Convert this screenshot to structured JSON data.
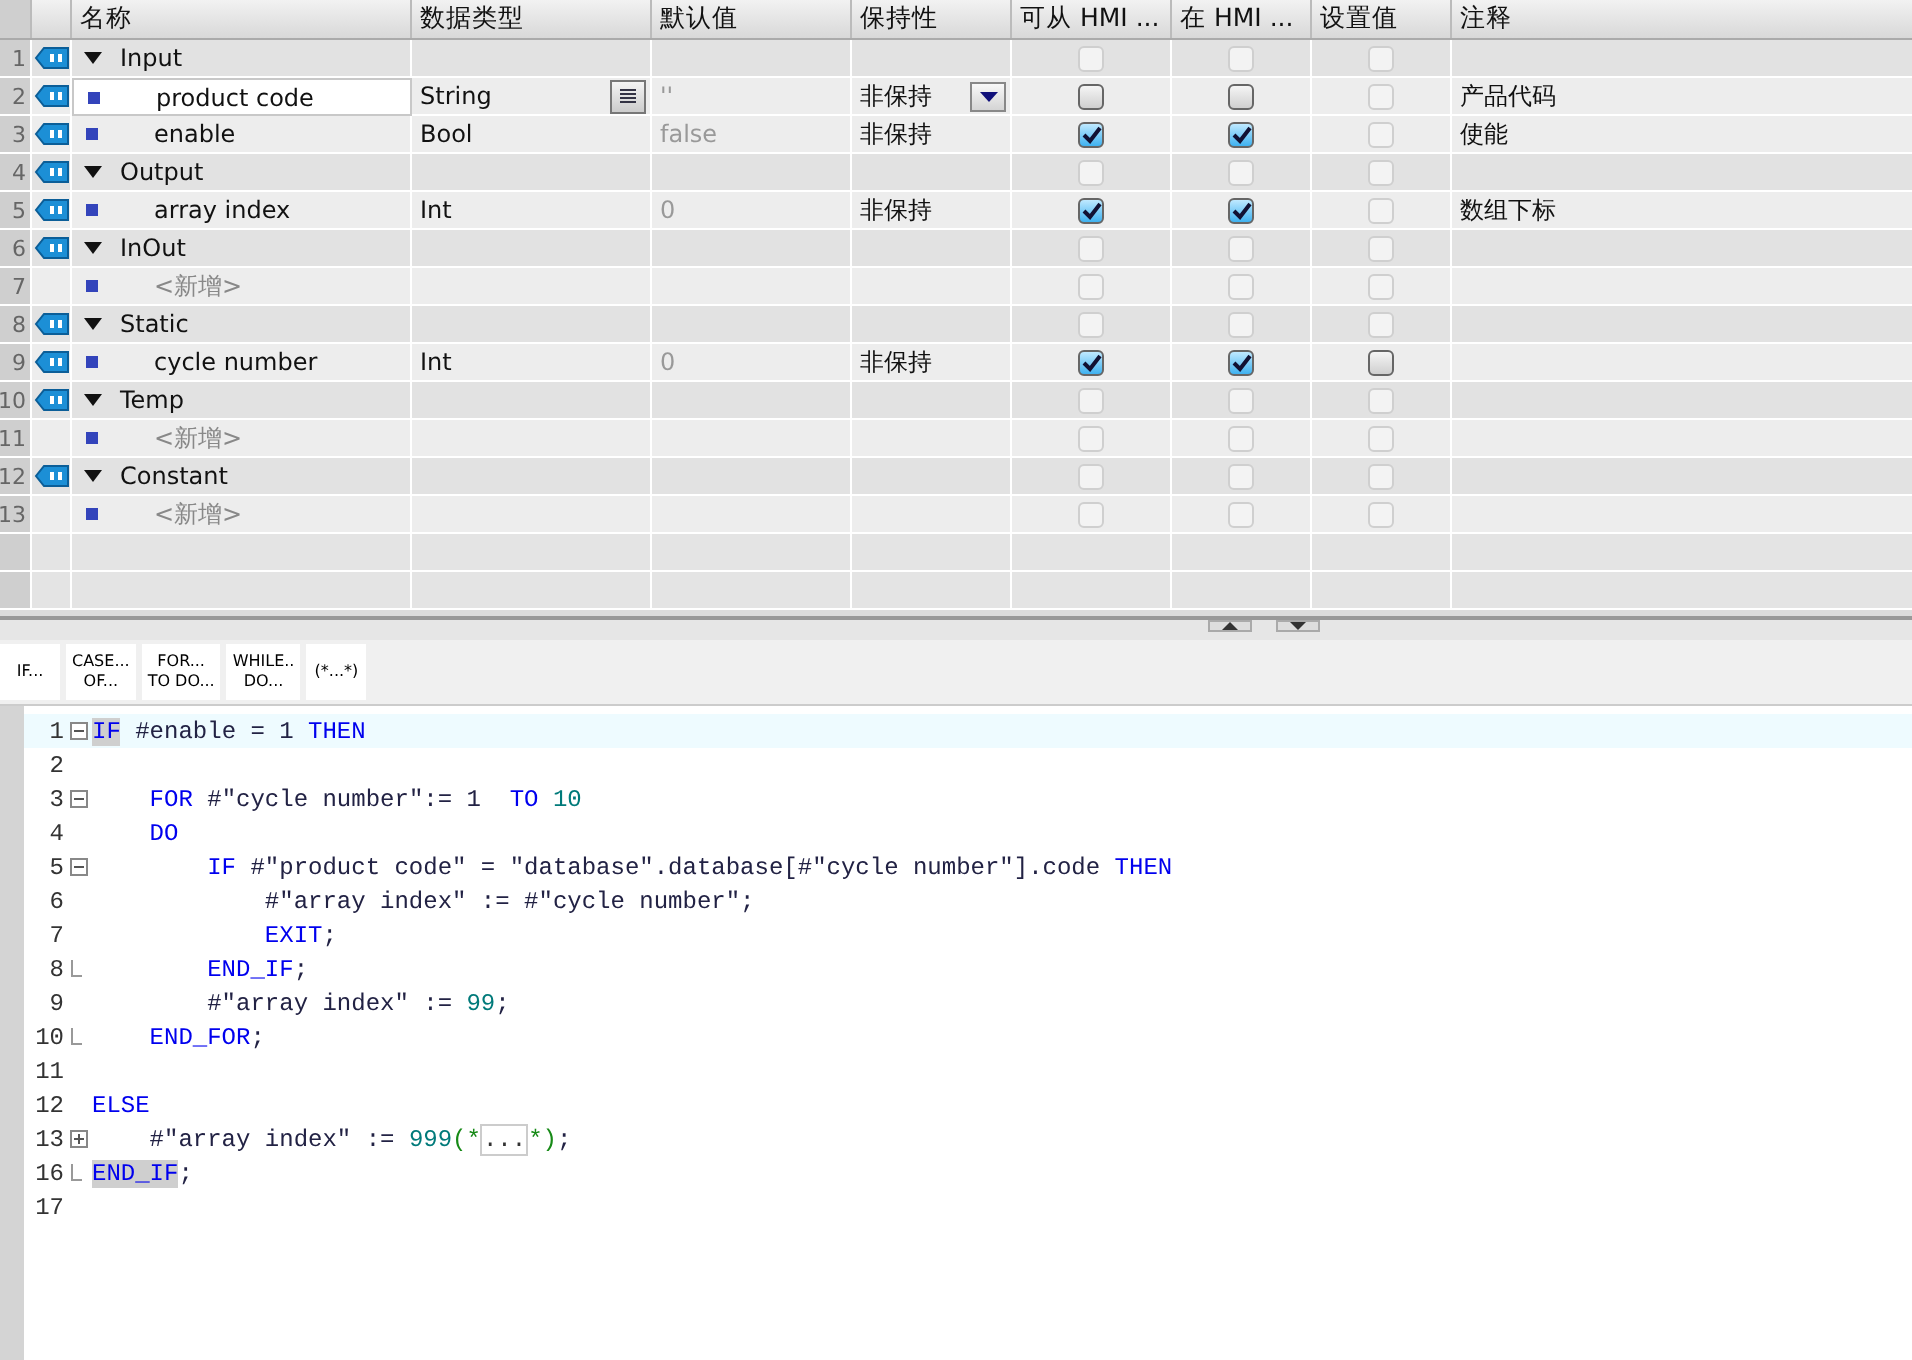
{
  "table": {
    "columns": [
      "名称",
      "数据类型",
      "默认值",
      "保持性",
      "可从 HMI ...",
      "在 HMI ...",
      "设置值",
      "注释"
    ],
    "rows": [
      {
        "number": "1",
        "kind": "section",
        "name": "Input",
        "type": "",
        "default": "",
        "retain": "",
        "comment": "",
        "selected": false,
        "checks": [
          {
            "checked": false,
            "enabled": false
          },
          {
            "checked": false,
            "enabled": false
          },
          {
            "checked": false,
            "enabled": false
          }
        ]
      },
      {
        "number": "2",
        "kind": "variable",
        "name": "product code",
        "type": "String",
        "default": "''",
        "retain": "非保持",
        "comment": "产品代码",
        "selected": true,
        "checks": [
          {
            "checked": false,
            "enabled": true
          },
          {
            "checked": false,
            "enabled": true
          },
          {
            "checked": false,
            "enabled": false
          }
        ]
      },
      {
        "number": "3",
        "kind": "variable",
        "name": "enable",
        "type": "Bool",
        "default": "false",
        "retain": "非保持",
        "comment": "使能",
        "selected": false,
        "checks": [
          {
            "checked": true,
            "enabled": true
          },
          {
            "checked": true,
            "enabled": true
          },
          {
            "checked": false,
            "enabled": false
          }
        ]
      },
      {
        "number": "4",
        "kind": "section",
        "name": "Output",
        "type": "",
        "default": "",
        "retain": "",
        "comment": "",
        "selected": false,
        "checks": [
          {
            "checked": false,
            "enabled": false
          },
          {
            "checked": false,
            "enabled": false
          },
          {
            "checked": false,
            "enabled": false
          }
        ]
      },
      {
        "number": "5",
        "kind": "variable",
        "name": "array index",
        "type": "Int",
        "default": "0",
        "retain": "非保持",
        "comment": "数组下标",
        "selected": false,
        "checks": [
          {
            "checked": true,
            "enabled": true
          },
          {
            "checked": true,
            "enabled": true
          },
          {
            "checked": false,
            "enabled": false
          }
        ]
      },
      {
        "number": "6",
        "kind": "section",
        "name": "InOut",
        "type": "",
        "default": "",
        "retain": "",
        "comment": "",
        "selected": false,
        "checks": [
          {
            "checked": false,
            "enabled": false
          },
          {
            "checked": false,
            "enabled": false
          },
          {
            "checked": false,
            "enabled": false
          }
        ]
      },
      {
        "number": "7",
        "kind": "add",
        "name": "<新增>",
        "type": "",
        "default": "",
        "retain": "",
        "comment": "",
        "selected": false,
        "checks": [
          {
            "checked": false,
            "enabled": false
          },
          {
            "checked": false,
            "enabled": false
          },
          {
            "checked": false,
            "enabled": false
          }
        ]
      },
      {
        "number": "8",
        "kind": "section",
        "name": "Static",
        "type": "",
        "default": "",
        "retain": "",
        "comment": "",
        "selected": false,
        "checks": [
          {
            "checked": false,
            "enabled": false
          },
          {
            "checked": false,
            "enabled": false
          },
          {
            "checked": false,
            "enabled": false
          }
        ]
      },
      {
        "number": "9",
        "kind": "variable",
        "name": "cycle number",
        "type": "Int",
        "default": "0",
        "retain": "非保持",
        "comment": "",
        "selected": false,
        "checks": [
          {
            "checked": true,
            "enabled": true
          },
          {
            "checked": true,
            "enabled": true
          },
          {
            "checked": false,
            "enabled": true
          }
        ]
      },
      {
        "number": "10",
        "kind": "section",
        "name": "Temp",
        "type": "",
        "default": "",
        "retain": "",
        "comment": "",
        "selected": false,
        "checks": [
          {
            "checked": false,
            "enabled": false
          },
          {
            "checked": false,
            "enabled": false
          },
          {
            "checked": false,
            "enabled": false
          }
        ]
      },
      {
        "number": "11",
        "kind": "add",
        "name": "<新增>",
        "type": "",
        "default": "",
        "retain": "",
        "comment": "",
        "selected": false,
        "checks": [
          {
            "checked": false,
            "enabled": false
          },
          {
            "checked": false,
            "enabled": false
          },
          {
            "checked": false,
            "enabled": false
          }
        ]
      },
      {
        "number": "12",
        "kind": "section",
        "name": "Constant",
        "type": "",
        "default": "",
        "retain": "",
        "comment": "",
        "selected": false,
        "checks": [
          {
            "checked": false,
            "enabled": false
          },
          {
            "checked": false,
            "enabled": false
          },
          {
            "checked": false,
            "enabled": false
          }
        ]
      },
      {
        "number": "13",
        "kind": "add",
        "name": "<新增>",
        "type": "",
        "default": "",
        "retain": "",
        "comment": "",
        "selected": false,
        "checks": [
          {
            "checked": false,
            "enabled": false
          },
          {
            "checked": false,
            "enabled": false
          },
          {
            "checked": false,
            "enabled": false
          }
        ]
      }
    ]
  },
  "toolbar": [
    {
      "lines": [
        "IF..."
      ]
    },
    {
      "lines": [
        "CASE...",
        "OF..."
      ]
    },
    {
      "lines": [
        "FOR...",
        "TO DO..."
      ]
    },
    {
      "lines": [
        "WHILE..",
        "DO..."
      ]
    },
    {
      "lines": [
        "(*...*)"
      ]
    }
  ],
  "code": [
    {
      "number": "1",
      "foldable": true,
      "collapsed": false,
      "block_end": false,
      "current": true,
      "tokens": [
        {
          "kind": "keyword",
          "text": "IF",
          "match": true
        },
        {
          "kind": "text",
          "text": " #enable = "
        },
        {
          "kind": "text",
          "text": "1"
        },
        {
          "kind": "keyword",
          "text": " THEN"
        }
      ]
    },
    {
      "number": "2",
      "foldable": false,
      "block_end": false,
      "current": false
    },
    {
      "number": "3",
      "foldable": true,
      "collapsed": false,
      "block_end": false,
      "current": false,
      "tokens": [
        {
          "kind": "keyword",
          "text": "    FOR"
        },
        {
          "kind": "text",
          "text": " #\"cycle number\":= "
        },
        {
          "kind": "text",
          "text": "1"
        },
        {
          "kind": "keyword",
          "text": "  TO"
        },
        {
          "kind": "number",
          "text": " 10"
        }
      ]
    },
    {
      "number": "4",
      "foldable": false,
      "block_end": false,
      "current": false,
      "tokens": [
        {
          "kind": "keyword",
          "text": "    DO"
        }
      ]
    },
    {
      "number": "5",
      "foldable": true,
      "collapsed": false,
      "block_end": false,
      "current": false,
      "tokens": [
        {
          "kind": "keyword",
          "text": "        IF"
        },
        {
          "kind": "text",
          "text": " #\"product code\" = \"database\".database[#\"cycle number\"].code"
        },
        {
          "kind": "keyword",
          "text": " THEN"
        }
      ]
    },
    {
      "number": "6",
      "foldable": false,
      "block_end": false,
      "current": false,
      "tokens": [
        {
          "kind": "text",
          "text": "            #\"array index\" := #\"cycle number\";"
        }
      ]
    },
    {
      "number": "7",
      "foldable": false,
      "block_end": false,
      "current": false,
      "tokens": [
        {
          "kind": "keyword",
          "text": "            EXIT"
        },
        {
          "kind": "text",
          "text": ";"
        }
      ]
    },
    {
      "number": "8",
      "foldable": false,
      "block_end": true,
      "current": false,
      "tokens": [
        {
          "kind": "keyword",
          "text": "        END_IF"
        },
        {
          "kind": "text",
          "text": ";"
        }
      ]
    },
    {
      "number": "9",
      "foldable": false,
      "block_end": false,
      "current": false,
      "tokens": [
        {
          "kind": "text",
          "text": "        #\"array index\" := "
        },
        {
          "kind": "number",
          "text": "99"
        },
        {
          "kind": "text",
          "text": ";"
        }
      ]
    },
    {
      "number": "10",
      "foldable": false,
      "block_end": true,
      "current": false,
      "tokens": [
        {
          "kind": "keyword",
          "text": "    END_FOR"
        },
        {
          "kind": "text",
          "text": ";"
        }
      ]
    },
    {
      "number": "11",
      "foldable": false,
      "block_end": false,
      "current": false
    },
    {
      "number": "12",
      "foldable": false,
      "block_end": false,
      "current": false,
      "tokens": [
        {
          "kind": "keyword",
          "text": "ELSE"
        }
      ]
    },
    {
      "number": "13",
      "foldable": true,
      "collapsed": true,
      "block_end": false,
      "current": false,
      "tokens": [
        {
          "kind": "text",
          "text": "    #\"array index\" := "
        },
        {
          "kind": "number",
          "text": "999"
        },
        {
          "kind": "comment",
          "text": "(*"
        },
        {
          "kind": "collapsed",
          "text": "..."
        },
        {
          "kind": "comment",
          "text": "*)"
        },
        {
          "kind": "text",
          "text": ";"
        }
      ]
    },
    {
      "number": "16",
      "foldable": false,
      "block_end": true,
      "current": false,
      "tokens": [
        {
          "kind": "keyword",
          "text": "END_IF",
          "match": true
        },
        {
          "kind": "text",
          "text": ";"
        }
      ]
    },
    {
      "number": "17",
      "foldable": false,
      "block_end": false,
      "current": false
    }
  ]
}
